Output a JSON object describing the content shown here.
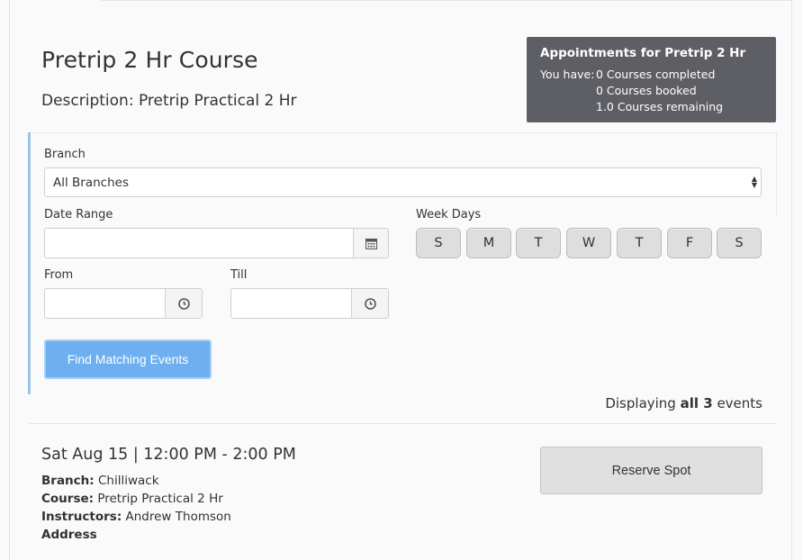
{
  "course": {
    "title": "Pretrip 2 Hr Course",
    "description": "Description: Pretrip Practical 2 Hr"
  },
  "appointments": {
    "title": "Appointments for Pretrip 2 Hr",
    "you_have_label": "You have:",
    "completed": "0 Courses completed",
    "booked": "0 Courses booked",
    "remaining": "1.0 Courses remaining"
  },
  "filters": {
    "branch_label": "Branch",
    "branch_selected": "All Branches",
    "date_range_label": "Date Range",
    "date_range_value": "",
    "week_days_label": "Week Days",
    "week_days": [
      "S",
      "M",
      "T",
      "W",
      "T",
      "F",
      "S"
    ],
    "from_label": "From",
    "from_value": "",
    "till_label": "Till",
    "till_value": "",
    "find_button": "Find Matching Events"
  },
  "results": {
    "prefix": "Displaying ",
    "bold": "all 3",
    "suffix": " events"
  },
  "event": {
    "datetime": "Sat Aug 15 | 12:00 PM - 2:00 PM",
    "branch_label": "Branch:",
    "branch_value": " Chilliwack",
    "course_label": "Course:",
    "course_value": " Pretrip Practical 2 Hr",
    "instructors_label": "Instructors:",
    "instructors_value": " Andrew Thomson",
    "address_label": "Address",
    "reserve_button": "Reserve Spot"
  },
  "colors": {
    "appointments_bg": "#5e5f65",
    "find_button_bg": "#6eb0ef",
    "panel_accent": "#9dc3e6"
  },
  "icons": {
    "calendar": "calendar-icon",
    "clock": "clock-icon",
    "select": "select-arrows-icon"
  }
}
